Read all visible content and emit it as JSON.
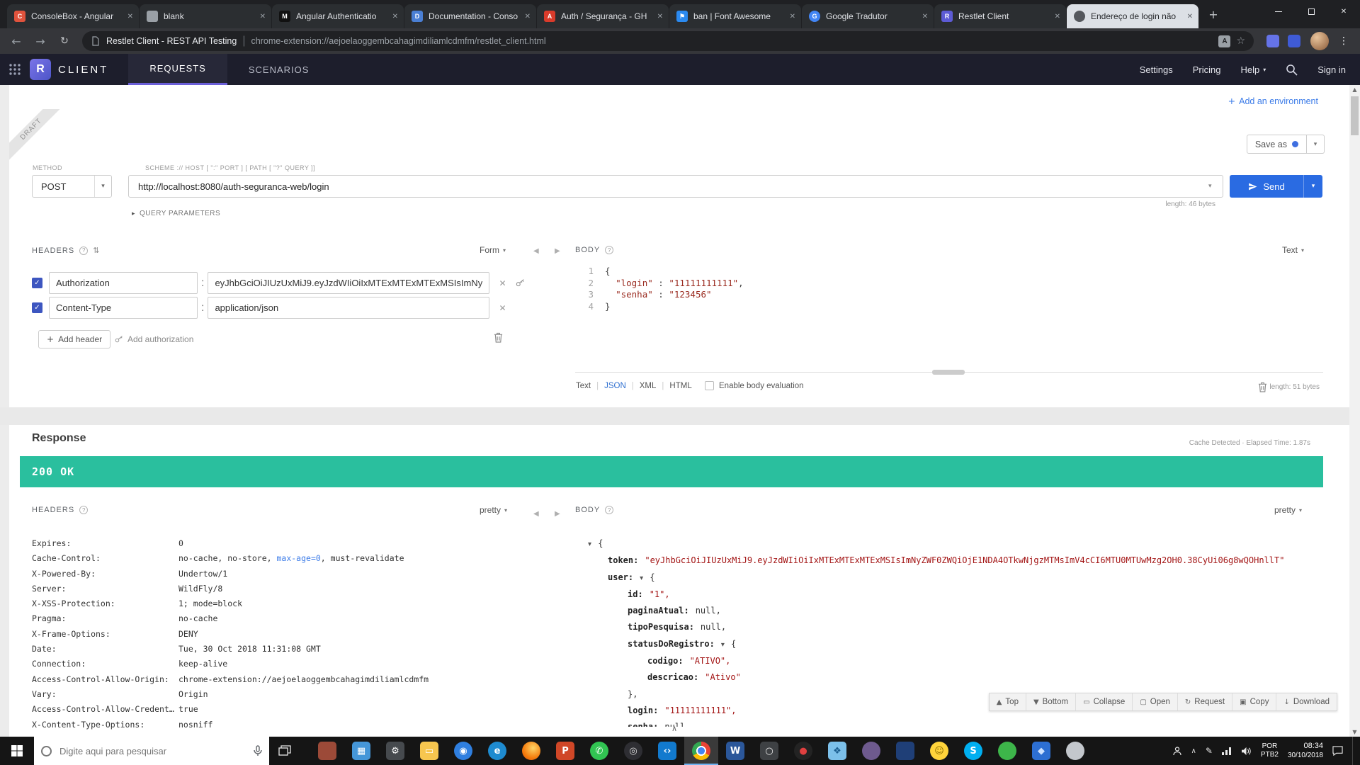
{
  "colors": {
    "accent_purple": "#6b5fd8",
    "send_blue": "#2a6be2",
    "link_blue": "#3b7be8",
    "status_green": "#2abf9e"
  },
  "browser": {
    "tabs": [
      {
        "title": "ConsoleBox - Angular",
        "fav_bg": "#e0533d",
        "fav_glyph": "C"
      },
      {
        "title": "blank",
        "fav_bg": "#9aa0a6",
        "fav_glyph": ""
      },
      {
        "title": "Angular Authenticatio",
        "fav_bg": "#111111",
        "fav_glyph": "M"
      },
      {
        "title": "Documentation - Conso",
        "fav_bg": "#4a7fd4",
        "fav_glyph": "D"
      },
      {
        "title": "Auth / Segurança - GH",
        "fav_bg": "#d93b2b",
        "fav_glyph": "A"
      },
      {
        "title": "ban | Font Awesome",
        "fav_bg": "#2b8af0",
        "fav_glyph": "⚑"
      },
      {
        "title": "Google Tradutor",
        "fav_bg": "#4285f4",
        "fav_glyph": "G",
        "fav_round": true
      },
      {
        "title": "Restlet Client",
        "fav_bg": "#5d5bd5",
        "fav_glyph": "R"
      },
      {
        "title": "Endereço de login não",
        "fav_bg": "#54575c",
        "fav_glyph": "",
        "fav_round": true,
        "light": true
      }
    ],
    "nav": {
      "page_title": "Restlet Client - REST API Testing",
      "separator": "|",
      "url": "chrome-extension://aejoelaoggembcahagimdiliamlcdmfm/restlet_client.html"
    }
  },
  "app_header": {
    "logo_letter": "R",
    "brand": "CLIENT",
    "tabs": [
      {
        "label": "REQUESTS"
      },
      {
        "label": "SCENARIOS"
      }
    ],
    "menu": [
      "Settings",
      "Pricing",
      "Help"
    ],
    "sign_in": "Sign in"
  },
  "request": {
    "add_environment": "Add an environment",
    "draft": "DRAFT",
    "save_as": "Save as",
    "method_label": "METHOD",
    "method": "POST",
    "scheme_label": "SCHEME :// HOST [ \":\" PORT ] [ PATH [ \"?\" QUERY ]]",
    "url": "http://localhost:8080/auth-seguranca-web/login",
    "send": "Send",
    "url_length": "length: 46 bytes",
    "query_parameters": "QUERY PARAMETERS",
    "headers": {
      "title": "HEADERS",
      "mode": "Form",
      "rows": [
        {
          "checked": true,
          "name": "Authorization",
          "value": "eyJhbGciOiJIUzUxMiJ9.eyJzdWIiOiIxMTExMTExMTExMSIsImNy",
          "key_icon": true
        },
        {
          "checked": true,
          "name": "Content-Type",
          "value": "application/json",
          "key_icon": false
        }
      ],
      "add_header": "Add header",
      "add_authorization": "Add authorization"
    },
    "body": {
      "title": "BODY",
      "mode": "Text",
      "lines": [
        [
          {
            "t": "{",
            "c": "p"
          }
        ],
        [
          {
            "t": "  ",
            "c": "p"
          },
          {
            "t": "\"login\"",
            "c": "s"
          },
          {
            "t": " : ",
            "c": "p"
          },
          {
            "t": "\"11111111111\"",
            "c": "s"
          },
          {
            "t": ",",
            "c": "p"
          }
        ],
        [
          {
            "t": "  ",
            "c": "p"
          },
          {
            "t": "\"senha\"",
            "c": "s"
          },
          {
            "t": " : ",
            "c": "p"
          },
          {
            "t": "\"123456\"",
            "c": "s"
          }
        ],
        [
          {
            "t": "}",
            "c": "p"
          }
        ]
      ],
      "format_options": [
        "Text",
        "JSON",
        "XML",
        "HTML"
      ],
      "active_format": "JSON",
      "eval_label": "Enable body evaluation",
      "length": "length: 51 bytes"
    }
  },
  "response": {
    "title": "Response",
    "meta": "Cache Detected · Elapsed Time: 1.87s",
    "status": "200 OK",
    "status_color": "#2abf9e",
    "headers": {
      "title": "HEADERS",
      "mode": "pretty",
      "items": [
        {
          "name": "Expires:",
          "parts": [
            {
              "t": "0"
            }
          ]
        },
        {
          "name": "Cache-Control:",
          "parts": [
            {
              "t": "no-cache, no-store, "
            },
            {
              "t": "max-age=0",
              "link": true
            },
            {
              "t": ", must-revalidate"
            }
          ]
        },
        {
          "name": "X-Powered-By:",
          "parts": [
            {
              "t": "Undertow/1"
            }
          ]
        },
        {
          "name": "Server:",
          "parts": [
            {
              "t": "WildFly/8"
            }
          ]
        },
        {
          "name": "X-XSS-Protection:",
          "parts": [
            {
              "t": "1; mode=block"
            }
          ]
        },
        {
          "name": "Pragma:",
          "parts": [
            {
              "t": "no-cache"
            }
          ]
        },
        {
          "name": "X-Frame-Options:",
          "parts": [
            {
              "t": "DENY"
            }
          ]
        },
        {
          "name": "Date:",
          "parts": [
            {
              "t": "Tue, 30 Oct 2018 11:31:08 GMT"
            }
          ]
        },
        {
          "name": "Connection:",
          "parts": [
            {
              "t": "keep-alive"
            }
          ]
        },
        {
          "name": "Access-Control-Allow-Origin:",
          "parts": [
            {
              "t": "chrome-extension://aejoelaoggembcahagimdiliamlcdmfm"
            }
          ]
        },
        {
          "name": "Vary:",
          "parts": [
            {
              "t": "Origin"
            }
          ]
        },
        {
          "name": "Access-Control-Allow-Credentials:",
          "parts": [
            {
              "t": "true"
            }
          ]
        },
        {
          "name": "X-Content-Type-Options:",
          "parts": [
            {
              "t": "nosniff"
            }
          ]
        }
      ]
    },
    "body": {
      "title": "BODY",
      "mode": "pretty",
      "tree": [
        {
          "indent": 0,
          "toggle": true,
          "brace": "{"
        },
        {
          "indent": 1,
          "key": "token:",
          "value": "\"eyJhbGciOiJIUzUxMiJ9.eyJzdWIiOiIxMTExMTExMTExMSIsImNyZWF0ZWQiOjE1NDA4OTkwNjgzMTMsImV4cCI6MTU0MTUwMzg2OH0.38CyUi06g8wQOHnllT\"",
          "vclass": "str"
        },
        {
          "indent": 1,
          "key": "user:",
          "toggle": true,
          "brace": "{"
        },
        {
          "indent": 2,
          "key": "id:",
          "value": "\"1\",",
          "vclass": "str"
        },
        {
          "indent": 2,
          "key": "paginaAtual:",
          "value": "null,",
          "vclass": "nul"
        },
        {
          "indent": 2,
          "key": "tipoPesquisa:",
          "value": "null,",
          "vclass": "nul"
        },
        {
          "indent": 2,
          "key": "statusDoRegistro:",
          "toggle": true,
          "brace": "{"
        },
        {
          "indent": 3,
          "key": "codigo:",
          "value": "\"ATIVO\",",
          "vclass": "str"
        },
        {
          "indent": 3,
          "key": "descricao:",
          "value": "\"Ativo\"",
          "vclass": "str"
        },
        {
          "indent": 2,
          "brace": "},"
        },
        {
          "indent": 2,
          "key": "login:",
          "value": "\"11111111111\",",
          "vclass": "str"
        },
        {
          "indent": 2,
          "key": "senha:",
          "value": "null,",
          "vclass": "nul"
        }
      ]
    },
    "toolbar": [
      {
        "icon": "▲",
        "label": "Top"
      },
      {
        "icon": "▼",
        "label": "Bottom"
      },
      {
        "icon": "▭",
        "label": "Collapse"
      },
      {
        "icon": "▢",
        "label": "Open"
      },
      {
        "icon": "↻",
        "label": "Request"
      },
      {
        "icon": "▣",
        "label": "Copy"
      },
      {
        "icon": "↓",
        "label": "Download"
      }
    ]
  },
  "taskbar": {
    "search_placeholder": "Digite aqui para pesquisar",
    "apps": [
      {
        "name": "app-1",
        "bg": "#9c4a38",
        "glyph": ""
      },
      {
        "name": "app-2",
        "bg": "#4596d8",
        "glyph": "▦"
      },
      {
        "name": "settings-gear",
        "bg": "#464a4e",
        "glyph": "⚙"
      },
      {
        "name": "file-explorer",
        "bg": "#f7c64f",
        "glyph": "▭"
      },
      {
        "name": "browser-compass",
        "bg": "#2f7fe0",
        "glyph": "◉",
        "round": true
      },
      {
        "name": "edge",
        "bg": "#1e8bd0",
        "glyph": "e",
        "round": true
      },
      {
        "name": "firefox",
        "bg": "radial-gradient(circle at 60% 35%, #ffd567, #f57d0d 60%, #d9500a)",
        "glyph": "",
        "round": true
      },
      {
        "name": "powerpoint",
        "bg": "#d04727",
        "glyph": "P"
      },
      {
        "name": "whatsapp",
        "bg": "#31c452",
        "glyph": "✆",
        "round": true
      },
      {
        "name": "app-dark",
        "bg": "#2e2e33",
        "glyph": "◎",
        "fg": "#dddddd",
        "round": true
      },
      {
        "name": "vscode",
        "bg": "#127ace",
        "glyph": "‹›"
      },
      {
        "name": "chrome",
        "chrome": true,
        "glyph": "",
        "round": true,
        "active": true
      },
      {
        "name": "word",
        "bg": "#2b579a",
        "glyph": "W"
      },
      {
        "name": "search-tool",
        "bg": "#3e4144",
        "glyph": "○",
        "fg": "#eeeeee"
      },
      {
        "name": "app-red-dot",
        "bg": "#232323",
        "glyph": "●",
        "fg": "#e04040",
        "round": true
      },
      {
        "name": "photos",
        "bg": "#7cc0ea",
        "glyph": "❖",
        "fg": "#1b5d8f"
      },
      {
        "name": "github-desktop",
        "bg": "#6e5a8e",
        "glyph": "",
        "round": true
      },
      {
        "name": "app-navy",
        "bg": "#1f3f77",
        "glyph": ""
      },
      {
        "name": "emoji-app",
        "bg": "#ffd43b",
        "glyph": "☺",
        "fg": "#8a6d00",
        "round": true
      },
      {
        "name": "skype",
        "bg": "#00aff0",
        "glyph": "S",
        "round": true
      },
      {
        "name": "app-green",
        "bg": "#3db54a",
        "glyph": "",
        "round": true
      },
      {
        "name": "app-diamond",
        "bg": "#2d6fd2",
        "glyph": "◆",
        "fg": "#cfe3ff"
      },
      {
        "name": "app-silver",
        "bg": "#c3c7cc",
        "glyph": "",
        "round": true
      }
    ],
    "tray": {
      "lang_line1": "POR",
      "lang_line2": "PTB2",
      "time": "08:34",
      "date": "30/10/2018"
    }
  }
}
